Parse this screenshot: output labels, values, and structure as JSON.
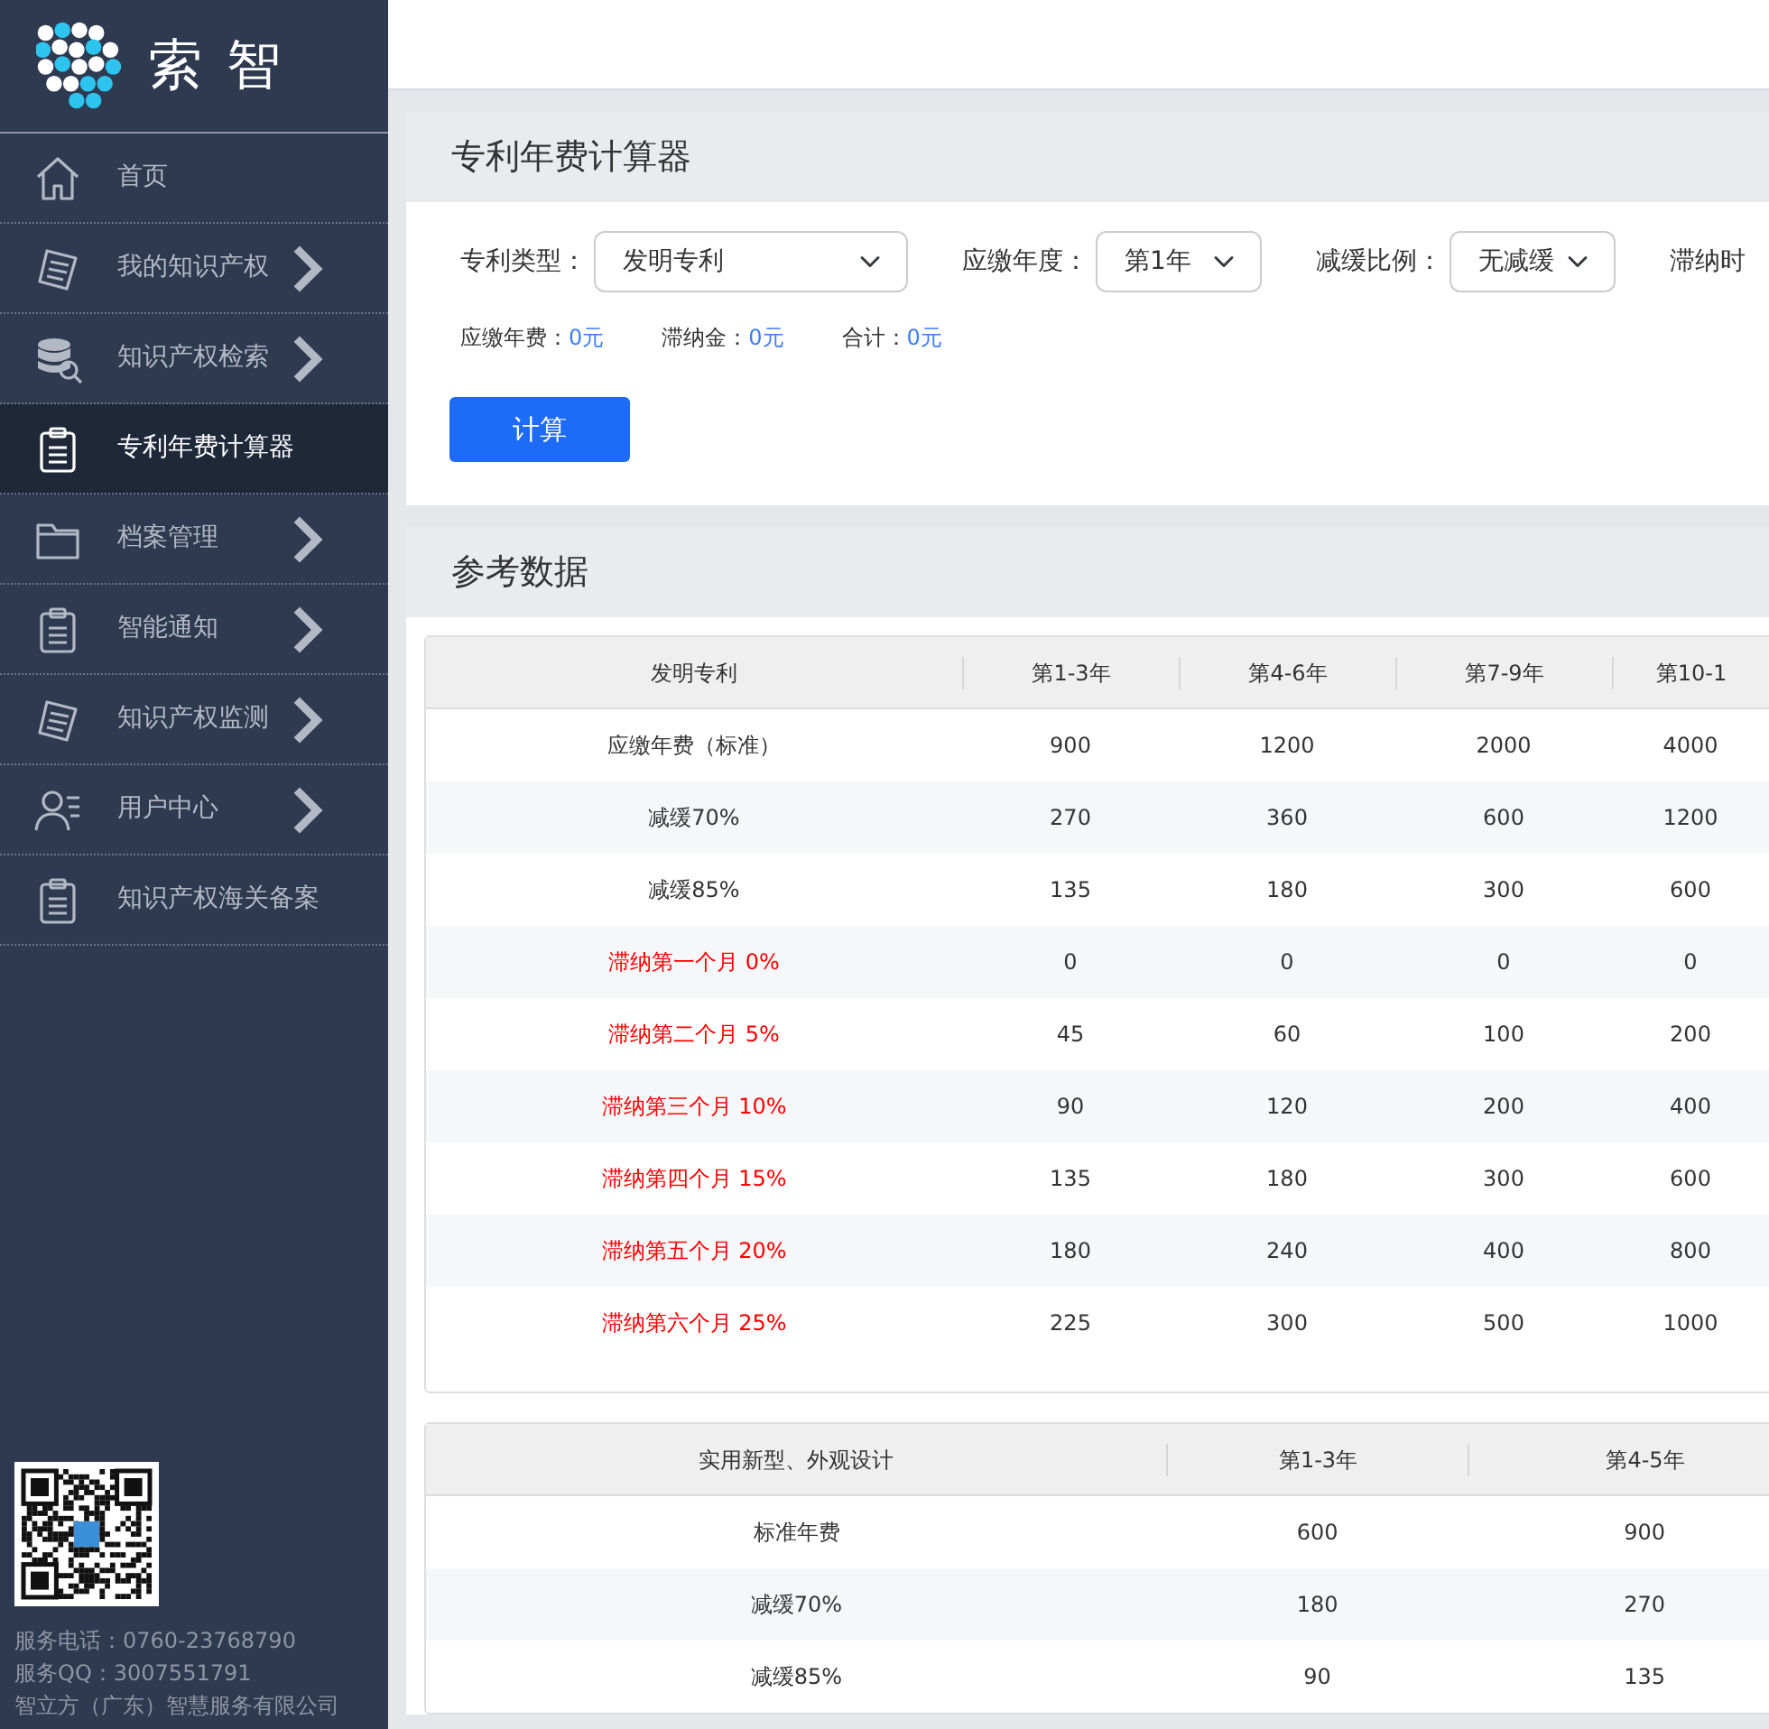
{
  "sidebar": {
    "logo_text": "索 智",
    "items": [
      {
        "label": "首页",
        "kind": "home",
        "expandable": false,
        "selected": false
      },
      {
        "label": "我的知识产权",
        "kind": "document",
        "expandable": true,
        "selected": false
      },
      {
        "label": "知识产权检索",
        "kind": "database",
        "expandable": true,
        "selected": false
      },
      {
        "label": "专利年费计算器",
        "kind": "clipboard",
        "expandable": false,
        "selected": true
      },
      {
        "label": "档案管理",
        "kind": "folder",
        "expandable": true,
        "selected": false
      },
      {
        "label": "智能通知",
        "kind": "clipboard",
        "expandable": true,
        "selected": false
      },
      {
        "label": "知识产权监测",
        "kind": "document",
        "expandable": true,
        "selected": false
      },
      {
        "label": "用户中心",
        "kind": "user",
        "expandable": true,
        "selected": false
      },
      {
        "label": "知识产权海关备案",
        "kind": "clipboard",
        "expandable": false,
        "selected": false
      }
    ],
    "contact": [
      "服务电话：0760-23768790",
      "服务QQ：3007551791",
      "智立方（广东）智慧服务有限公司"
    ]
  },
  "calculator": {
    "title": "专利年费计算器",
    "fields": [
      {
        "label": "专利类型：",
        "value": "发明专利"
      },
      {
        "label": "应缴年度：",
        "value": "第1年"
      },
      {
        "label": "减缓比例：",
        "value": "无减缓"
      }
    ],
    "cut_label": "滞纳时",
    "results": [
      {
        "label": "应缴年费：",
        "value": "0元"
      },
      {
        "label": "滞纳金：",
        "value": "0元"
      },
      {
        "label": "合计：",
        "value": "0元"
      }
    ],
    "button": "计算"
  },
  "reference": {
    "title": "参考数据",
    "tables": [
      {
        "columns": [
          "发明专利",
          "第1-3年",
          "第4-6年",
          "第7-9年",
          "第10-1"
        ],
        "rows": [
          {
            "cells": [
              "应缴年费（标准）",
              "900",
              "1200",
              "2000",
              "4000"
            ],
            "overdue": false
          },
          {
            "cells": [
              "减缓70%",
              "270",
              "360",
              "600",
              "1200"
            ],
            "overdue": false
          },
          {
            "cells": [
              "减缓85%",
              "135",
              "180",
              "300",
              "600"
            ],
            "overdue": false
          },
          {
            "cells": [
              "滞纳第一个月 0%",
              "0",
              "0",
              "0",
              "0"
            ],
            "overdue": true
          },
          {
            "cells": [
              "滞纳第二个月 5%",
              "45",
              "60",
              "100",
              "200"
            ],
            "overdue": true
          },
          {
            "cells": [
              "滞纳第三个月 10%",
              "90",
              "120",
              "200",
              "400"
            ],
            "overdue": true
          },
          {
            "cells": [
              "滞纳第四个月 15%",
              "135",
              "180",
              "300",
              "600"
            ],
            "overdue": true
          },
          {
            "cells": [
              "滞纳第五个月 20%",
              "180",
              "240",
              "400",
              "800"
            ],
            "overdue": true
          },
          {
            "cells": [
              "滞纳第六个月 25%",
              "225",
              "300",
              "500",
              "1000"
            ],
            "overdue": true
          }
        ]
      },
      {
        "columns": [
          "实用新型、外观设计",
          "第1-3年",
          "第4-5年"
        ],
        "rows": [
          {
            "cells": [
              "标准年费",
              "600",
              "900"
            ],
            "overdue": false
          },
          {
            "cells": [
              "减缓70%",
              "180",
              "270"
            ],
            "overdue": false
          },
          {
            "cells": [
              "减缓85%",
              "90",
              "135"
            ],
            "overdue": false
          }
        ]
      }
    ]
  }
}
